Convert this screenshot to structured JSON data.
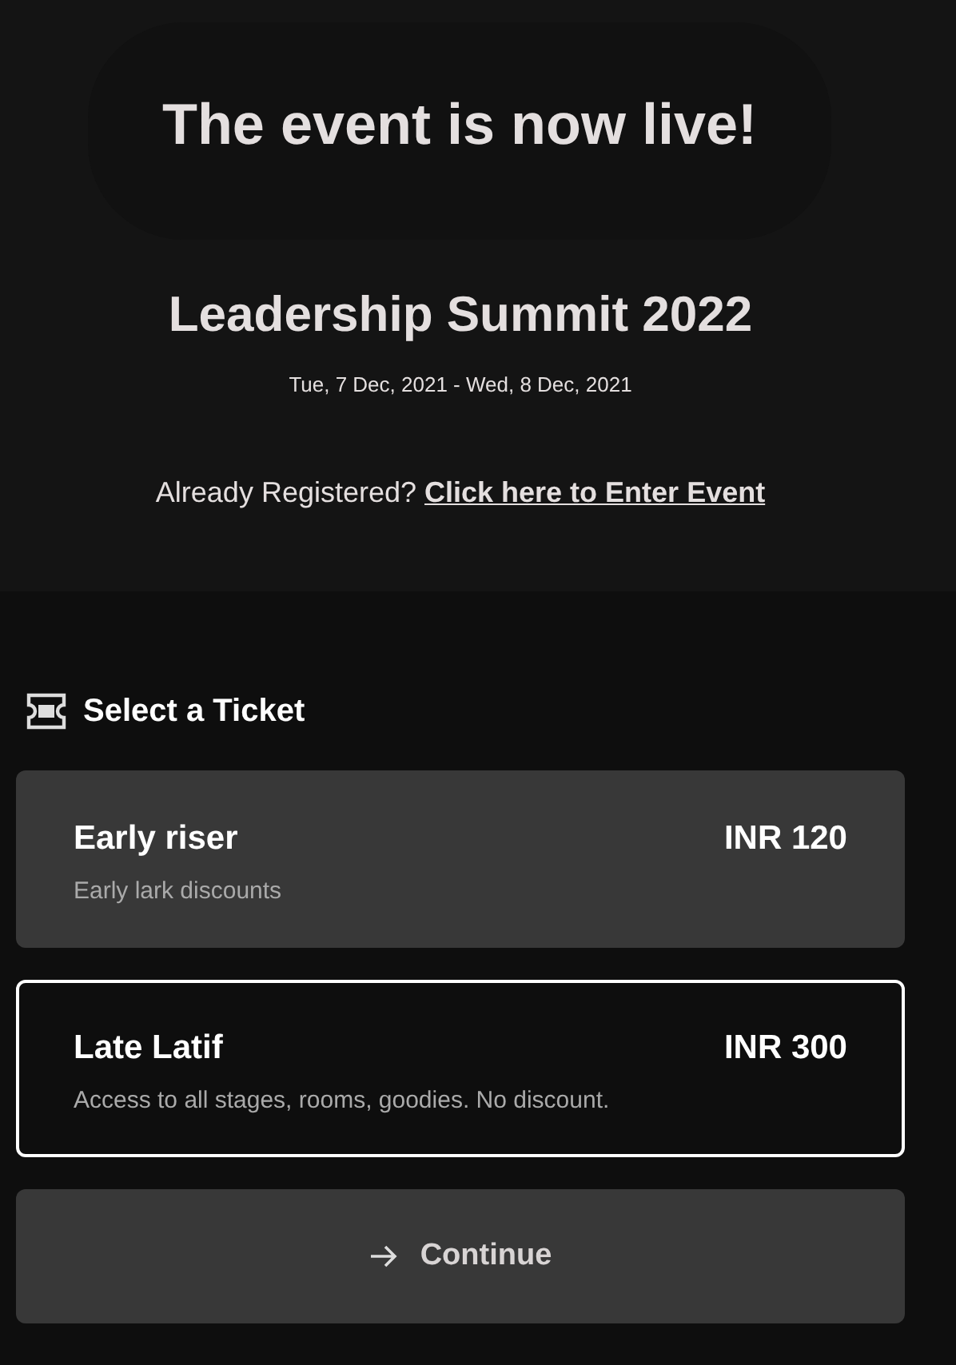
{
  "banner": {
    "title": "The event is now live!"
  },
  "event": {
    "name": "Leadership Summit 2022",
    "dates": "Tue, 7 Dec, 2021 - Wed, 8 Dec, 2021",
    "registered_prompt": "Already Registered?",
    "enter_link": "Click here to Enter Event"
  },
  "tickets_heading": "Select a Ticket",
  "tickets": [
    {
      "name": "Early riser",
      "price": "INR 120",
      "description": "Early lark discounts",
      "selected": false
    },
    {
      "name": "Late Latif",
      "price": "INR 300",
      "description": "Access to all stages, rooms, goodies. No discount.",
      "selected": true
    }
  ],
  "continue_button": "Continue"
}
